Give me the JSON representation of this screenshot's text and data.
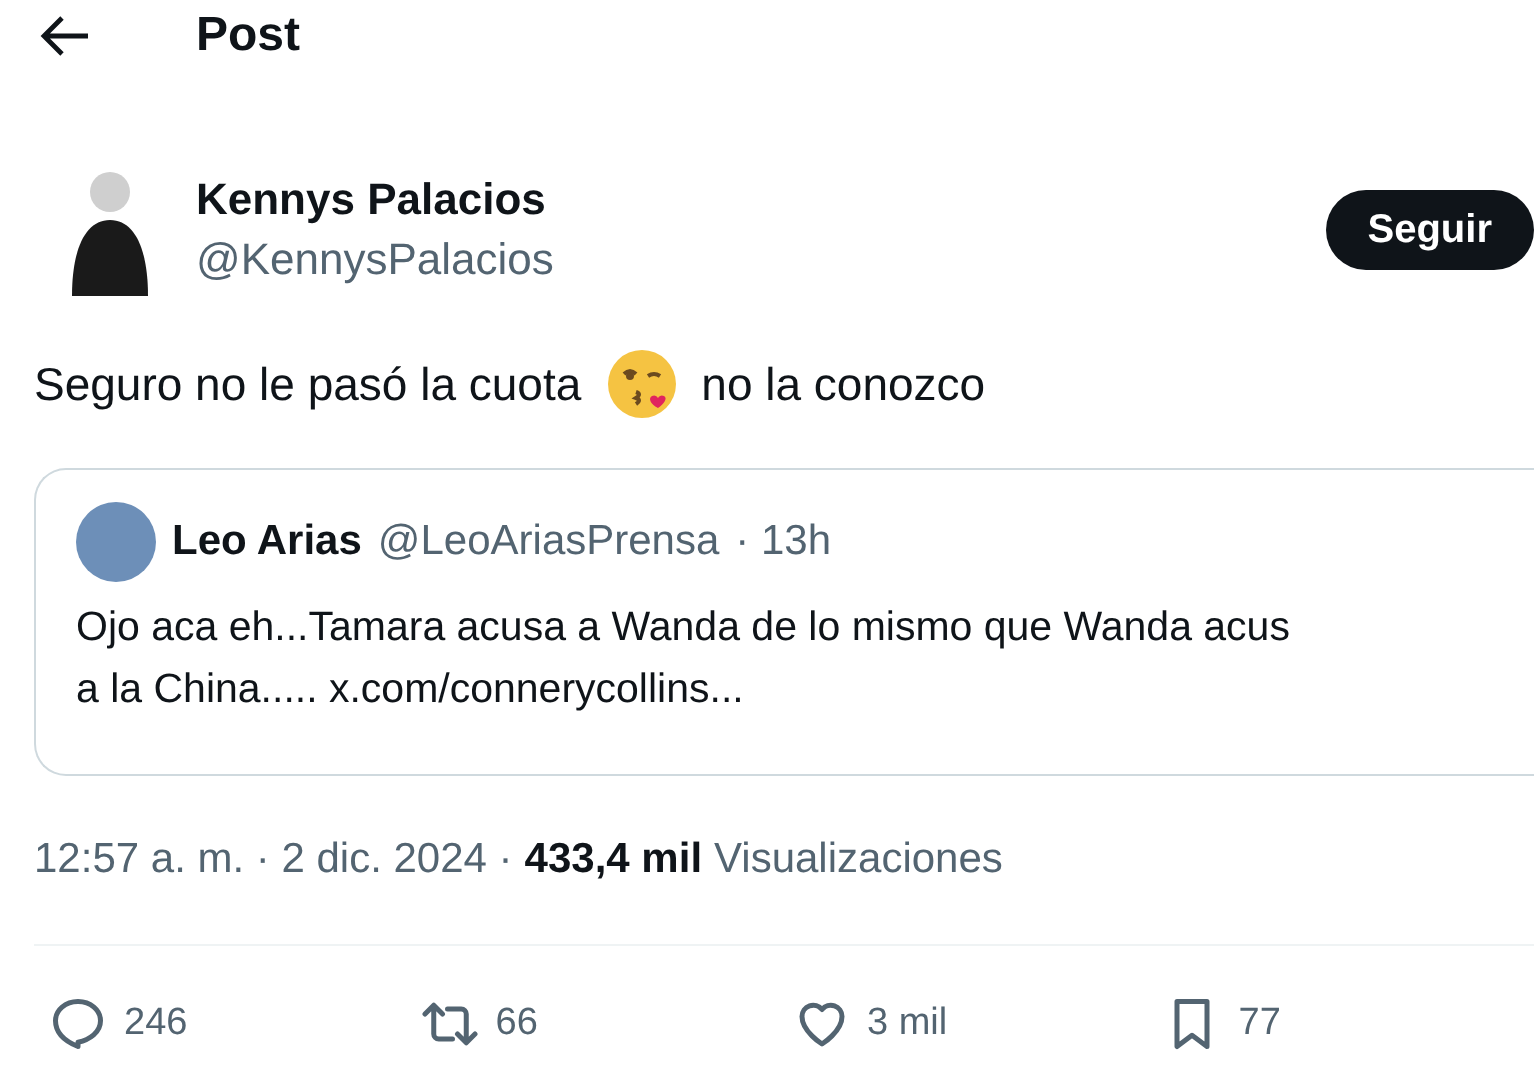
{
  "header": {
    "title": "Post"
  },
  "author": {
    "name": "Kennys Palacios",
    "handle": "@KennysPalacios",
    "follow_button": "Seguir"
  },
  "body": {
    "text_before": "Seguro no le pasó la cuota",
    "text_after": "no la conozco"
  },
  "quote": {
    "name": "Leo Arias",
    "handle": "@LeoAriasPrensa",
    "time": "· 13h",
    "line_1": "Ojo aca eh...Tamara acusa a Wanda de lo mismo que Wanda acus",
    "line_2": "a la China..... x.com/connerycollins..."
  },
  "meta": {
    "time": "12:57 a. m. · 2 dic. 2024 ·",
    "views": "433,4 mil",
    "views_label": "Visualizaciones"
  },
  "actions": [
    {
      "kind": "reply",
      "count": "246"
    },
    {
      "kind": "repost",
      "count": "66"
    },
    {
      "kind": "like",
      "count": "3 mil"
    },
    {
      "kind": "bookmark",
      "count": "77"
    }
  ]
}
